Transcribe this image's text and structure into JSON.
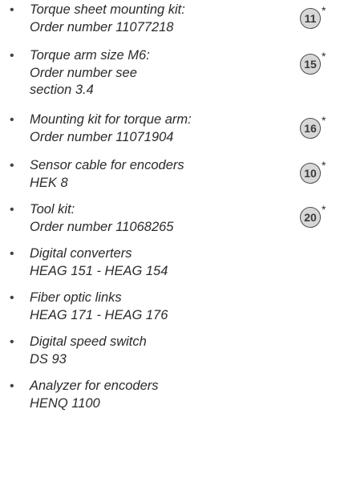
{
  "items": [
    {
      "bullet": "•",
      "text": "Torque sheet mounting kit:\nOrder number 11077218",
      "badge": "11",
      "star": "*"
    },
    {
      "bullet": "•",
      "text": "Torque arm size M6:\nOrder number see\nsection 3.4",
      "badge": "15",
      "star": "*"
    },
    {
      "bullet": "•",
      "text": "Mounting kit for torque arm:\nOrder number 11071904",
      "badge": "16",
      "star": "*"
    },
    {
      "bullet": "•",
      "text": "Sensor cable for encoders\nHEK 8",
      "badge": "10",
      "star": "*"
    },
    {
      "bullet": "•",
      "text": "Tool kit:\nOrder number 11068265",
      "badge": "20",
      "star": "*"
    },
    {
      "bullet": "•",
      "text": "Digital converters\nHEAG 151 - HEAG 154"
    },
    {
      "bullet": "•",
      "text": "Fiber optic links\nHEAG 171 - HEAG 176"
    },
    {
      "bullet": "•",
      "text": "Digital speed switch\nDS 93"
    },
    {
      "bullet": "•",
      "text": "Analyzer for encoders\nHENQ 1100"
    }
  ]
}
